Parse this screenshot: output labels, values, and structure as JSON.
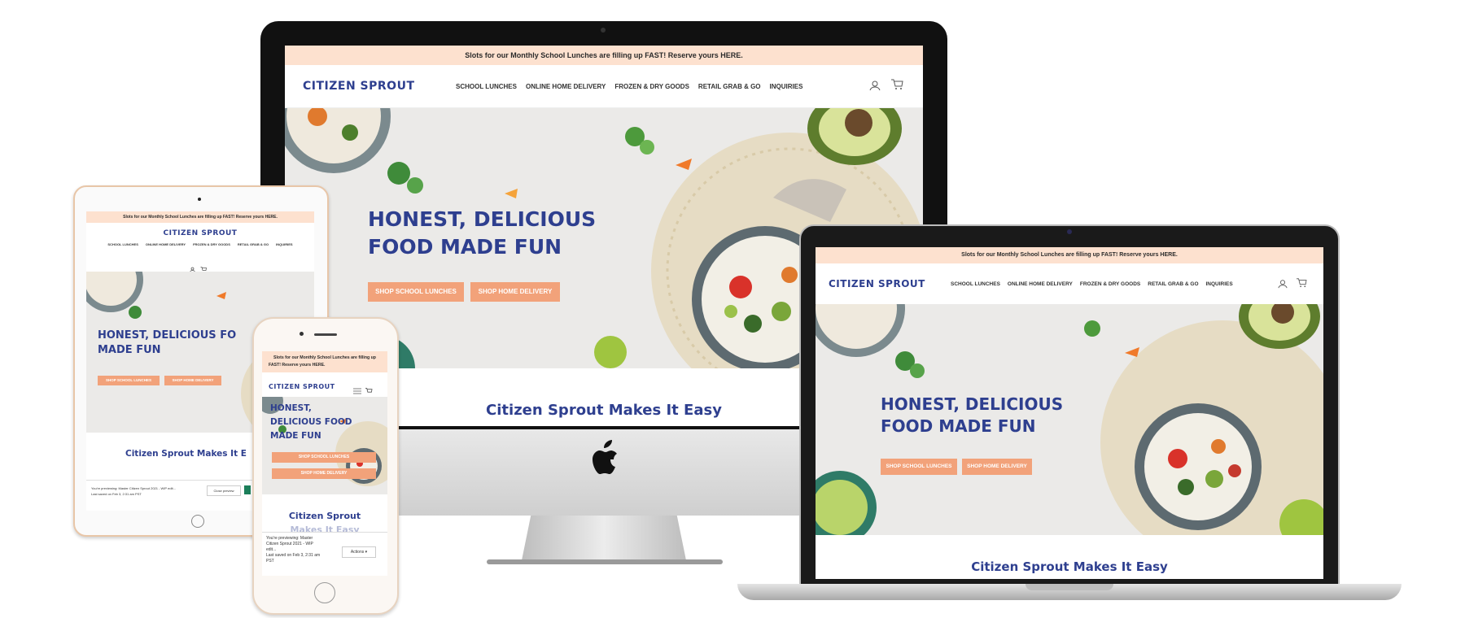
{
  "site": {
    "banner_text": "Slots for our Monthly School Lunches are filling up FAST! Reserve yours HERE.",
    "banner_wrap_1": "Slots for our Monthly School Lunches are filling up",
    "banner_wrap_2": "FAST! Reserve yours HERE.",
    "logo": "CITIZEN SPROUT",
    "nav": [
      "SCHOOL LUNCHES",
      "ONLINE HOME DELIVERY",
      "FROZEN & DRY GOODS",
      "RETAIL GRAB & GO",
      "INQUIRIES"
    ],
    "hero_line1": "HONEST, DELICIOUS",
    "hero_line2": "FOOD MADE FUN",
    "hero_tablet_line1": "HONEST, DELICIOUS FO",
    "hero_tablet_line2": "MADE FUN",
    "hero_phone_line1": "HONEST,",
    "hero_phone_line2": "DELICIOUS FOOD",
    "hero_phone_line3": "MADE FUN",
    "btn_school": "SHOP SCHOOL LUNCHES",
    "btn_home": "SHOP HOME DELIVERY",
    "section_title": "Citizen Sprout Makes It Easy",
    "section_title_clipped": "Citizen Sprout Makes It E",
    "section_phone_line1": "Citizen Sprout",
    "section_phone_line2": "Makes It Easy"
  },
  "preview_bar": {
    "tablet_line1": "You're previewing: Master Citizen Sprout 2021 - WIP edit...",
    "tablet_line2": "Last saved on Feb 3, 2:31 am PST",
    "close_label": "Close preview",
    "phone_line1": "You're previewing: Master",
    "phone_line2": "Citizen Sprout 2021 - WIP",
    "phone_line3": "edit...",
    "phone_line4": "Last saved on Feb 3, 2:31 am",
    "phone_line5": "PST",
    "actions_label": "Actions ▾"
  },
  "icons": [
    "account-icon",
    "cart-icon",
    "menu-icon",
    "chevron-down-icon",
    "apple-logo-icon"
  ],
  "colors": {
    "brand_blue": "#2e3f8f",
    "banner_peach": "#fde1cf",
    "button_orange": "#f2a27a"
  }
}
